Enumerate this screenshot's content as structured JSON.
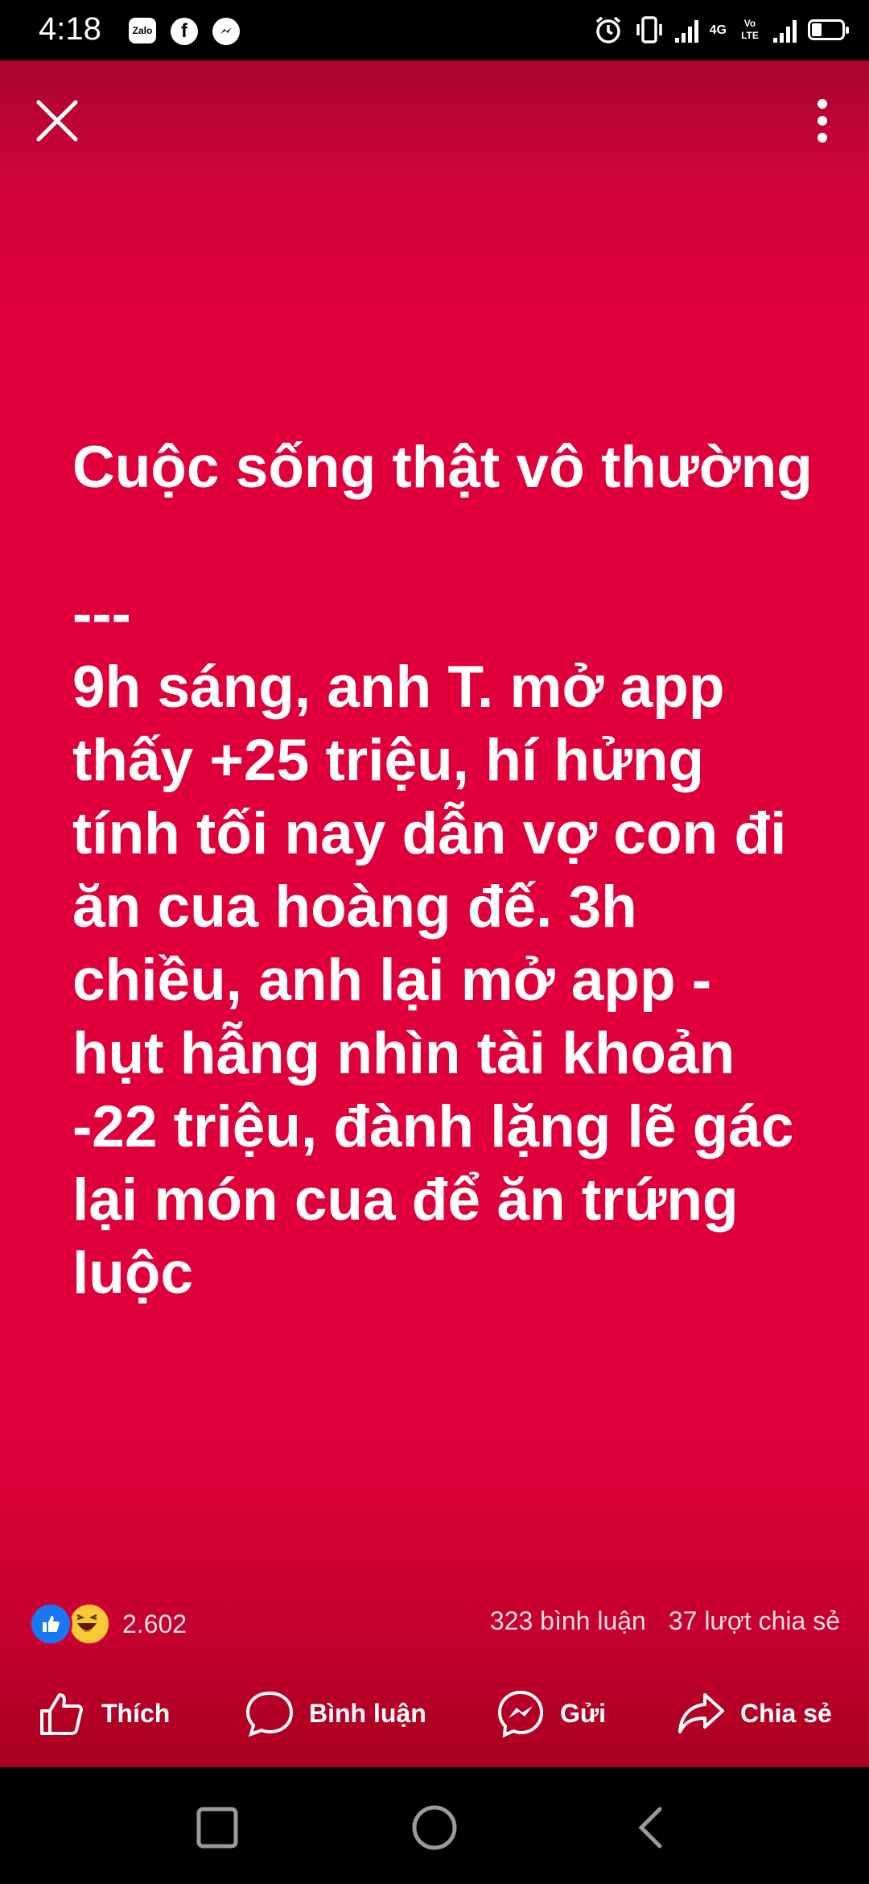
{
  "status_bar": {
    "time": "4:18",
    "app_icons": [
      "zalo-icon",
      "facebook-icon",
      "messenger-icon"
    ],
    "zalo_text": "Zalo",
    "network": "4G",
    "volte": "Vo LTE",
    "battery_percent": 40
  },
  "post": {
    "background_color": "#df003b",
    "text": "Cuộc sống thật vô thường\n\n---\n9h sáng, anh T. mở app thấy +25 triệu, hí hửng tính tối nay dẫn vợ con đi ăn cua hoàng đế. 3h chiều, anh lại mở app - hụt hẫng nhìn tài khoản -22 triệu, đành lặng lẽ gác lại món cua để ăn trứng luộc"
  },
  "engagement": {
    "reaction_count": "2.602",
    "comments": "323 bình luận",
    "shares": "37 lượt chia sẻ"
  },
  "actions": {
    "like": "Thích",
    "comment": "Bình luận",
    "send": "Gửi",
    "share": "Chia sẻ"
  },
  "colors": {
    "like_blue": "#1877f2",
    "haha_yellow": "#f7c937"
  }
}
